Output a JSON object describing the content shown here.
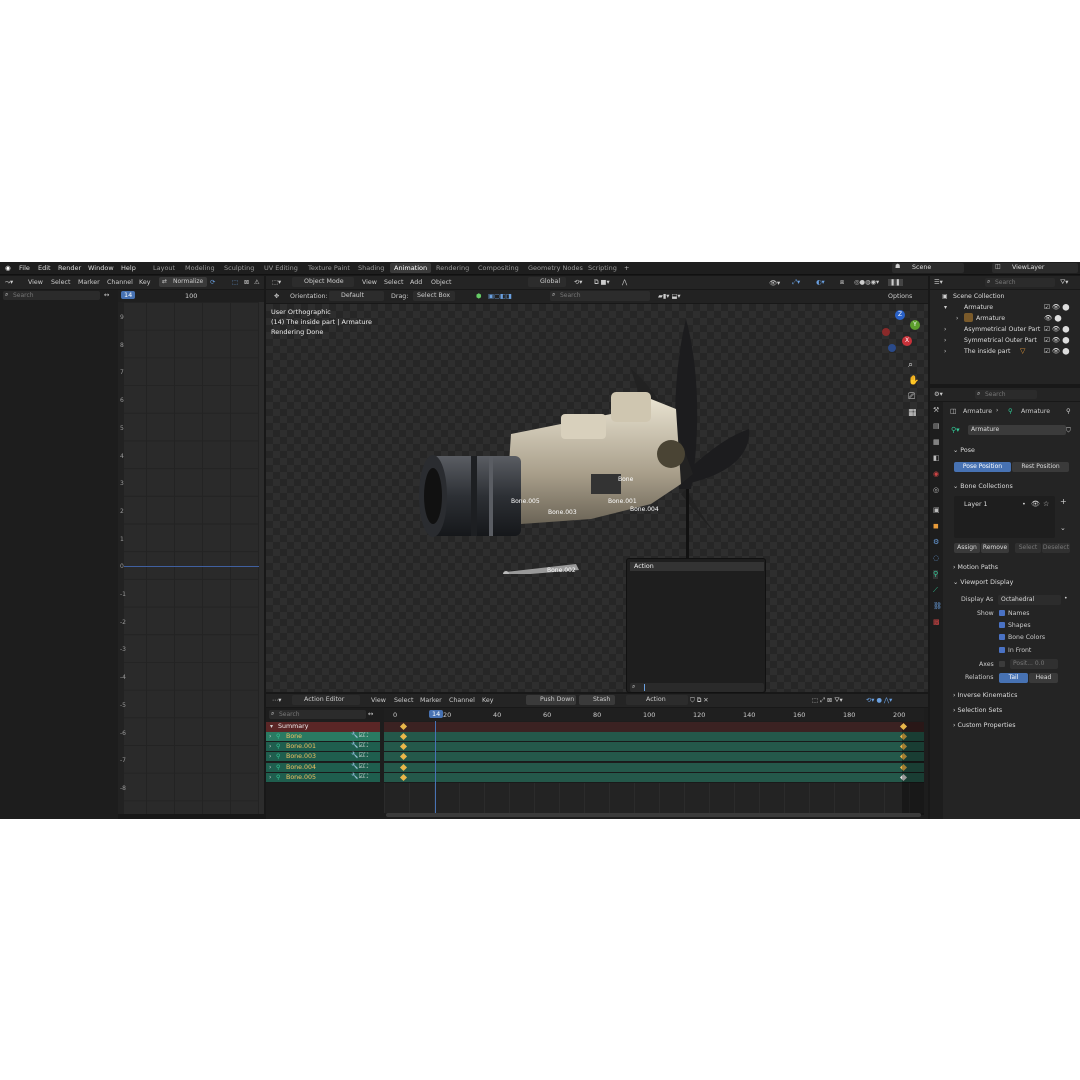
{
  "top_menu": [
    "File",
    "Edit",
    "Render",
    "Window",
    "Help"
  ],
  "workspaces": [
    "Layout",
    "Modeling",
    "Sculpting",
    "UV Editing",
    "Texture Paint",
    "Shading",
    "Animation",
    "Rendering",
    "Compositing",
    "Geometry Nodes",
    "Scripting"
  ],
  "active_workspace": "Animation",
  "scene": {
    "label": "Scene",
    "view_layer": "ViewLayer"
  },
  "graph_editor": {
    "menus": [
      "View",
      "Select",
      "Marker",
      "Channel",
      "Key"
    ],
    "normalize": "Normalize",
    "search_placeholder": "Search",
    "current_frame": "14",
    "frame_100": "100",
    "y_ticks": [
      "9",
      "8",
      "7",
      "6",
      "5",
      "4",
      "3",
      "2",
      "1",
      "0",
      "-1",
      "-2",
      "-3",
      "-4",
      "-5",
      "-6",
      "-7",
      "-8"
    ]
  },
  "viewport": {
    "mode": "Object Mode",
    "menus": [
      "View",
      "Select",
      "Add",
      "Object"
    ],
    "orientation_label": "Orientation:",
    "orientation_value": "Default",
    "drag_label": "Drag:",
    "drag_value": "Select Box",
    "transform": "Global",
    "search_placeholder": "Search",
    "options": "Options",
    "info_lines": [
      "User Orthographic",
      "(14) The inside part | Armature",
      "Rendering Done"
    ],
    "bones": [
      "Bone",
      "Bone.005",
      "Bone.003",
      "Bone.001",
      "Bone.004",
      "Bone.002"
    ],
    "axis": {
      "x": "X",
      "y": "Y",
      "z": "Z"
    }
  },
  "action_popup": {
    "title": "Action"
  },
  "dope_sheet": {
    "editor": "Action Editor",
    "menus": [
      "View",
      "Select",
      "Marker",
      "Channel",
      "Key"
    ],
    "push_down": "Push Down",
    "stash": "Stash",
    "action_label": "Action",
    "search_placeholder": "Search",
    "current_frame": "14",
    "frame_ticks": [
      "0",
      "20",
      "40",
      "60",
      "80",
      "100",
      "120",
      "140",
      "160",
      "180",
      "200"
    ],
    "summary": "Summary",
    "channels": [
      "Bone",
      "Bone.001",
      "Bone.003",
      "Bone.004",
      "Bone.005"
    ]
  },
  "outliner": {
    "search_placeholder": "Search",
    "items": [
      "Scene Collection",
      "Armature",
      "Armature",
      "Asymmetrical Outer Part",
      "Symmetrical Outer Part",
      "The inside part"
    ]
  },
  "properties": {
    "search_placeholder": "Search",
    "breadcrumb": [
      "Armature",
      "Armature"
    ],
    "data_name": "Armature",
    "pose": {
      "title": "Pose",
      "pose_position": "Pose Position",
      "rest_position": "Rest Position"
    },
    "bone_collections": {
      "title": "Bone Collections",
      "layer": "Layer 1",
      "assign": "Assign",
      "remove": "Remove",
      "select": "Select",
      "deselect": "Deselect"
    },
    "motion_paths": "Motion Paths",
    "viewport_display": {
      "title": "Viewport Display",
      "display_as_label": "Display As",
      "display_as_value": "Octahedral",
      "show_label": "Show",
      "show_items": [
        "Names",
        "Shapes",
        "Bone Colors",
        "In Front"
      ],
      "axes_label": "Axes",
      "axes_value": "Posit... 0.0",
      "relations_label": "Relations",
      "tail": "Tail",
      "head": "Head"
    },
    "inverse_kinematics": "Inverse Kinematics",
    "selection_sets": "Selection Sets",
    "custom_properties": "Custom Properties"
  }
}
